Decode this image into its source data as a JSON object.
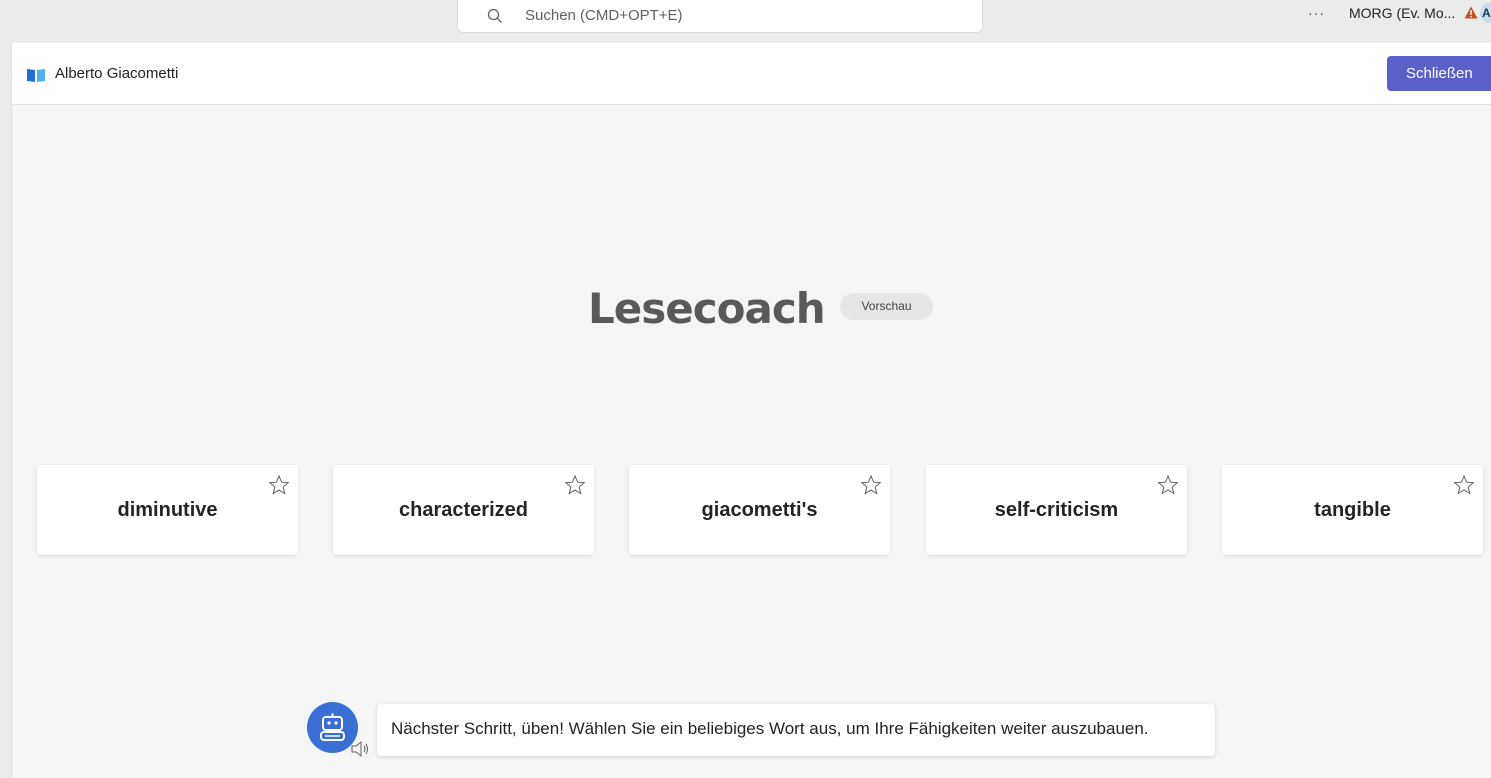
{
  "topbar": {
    "search_placeholder": "Suchen (CMD+OPT+E)",
    "more": "···",
    "org": "MORG (Ev. Mo...",
    "avatar_initial": "A"
  },
  "header": {
    "title": "Alberto Giacometti",
    "close_label": "Schließen"
  },
  "main": {
    "title": "Lesecoach",
    "badge": "Vorschau",
    "words": [
      "diminutive",
      "characterized",
      "giacometti's",
      "self-criticism",
      "tangible"
    ]
  },
  "coach": {
    "message": "Nächster Schritt, üben! Wählen Sie ein beliebiges Wort aus, um Ihre Fähigkeiten weiter auszubauen."
  },
  "colors": {
    "accent": "#5b5fc7",
    "bot": "#3a6fd6",
    "warning": "#c4314b"
  }
}
